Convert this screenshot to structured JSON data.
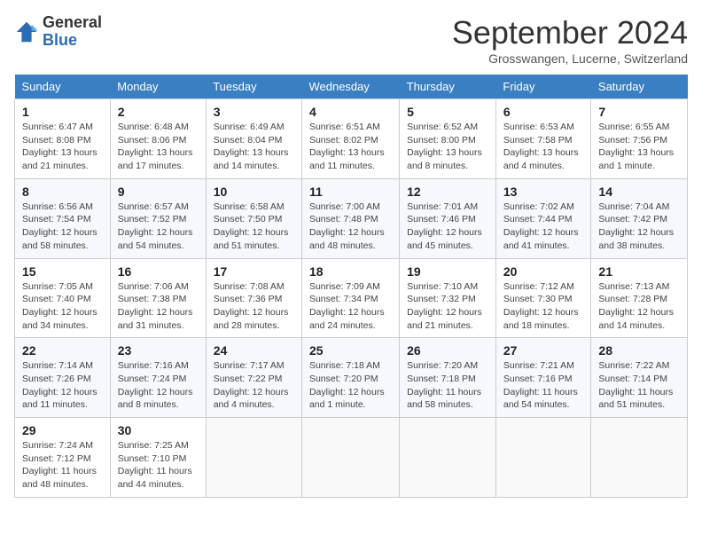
{
  "header": {
    "logo_general": "General",
    "logo_blue": "Blue",
    "month_title": "September 2024",
    "location": "Grosswangen, Lucerne, Switzerland"
  },
  "weekdays": [
    "Sunday",
    "Monday",
    "Tuesday",
    "Wednesday",
    "Thursday",
    "Friday",
    "Saturday"
  ],
  "weeks": [
    [
      {
        "day": "1",
        "sunrise": "Sunrise: 6:47 AM",
        "sunset": "Sunset: 8:08 PM",
        "daylight": "Daylight: 13 hours and 21 minutes."
      },
      {
        "day": "2",
        "sunrise": "Sunrise: 6:48 AM",
        "sunset": "Sunset: 8:06 PM",
        "daylight": "Daylight: 13 hours and 17 minutes."
      },
      {
        "day": "3",
        "sunrise": "Sunrise: 6:49 AM",
        "sunset": "Sunset: 8:04 PM",
        "daylight": "Daylight: 13 hours and 14 minutes."
      },
      {
        "day": "4",
        "sunrise": "Sunrise: 6:51 AM",
        "sunset": "Sunset: 8:02 PM",
        "daylight": "Daylight: 13 hours and 11 minutes."
      },
      {
        "day": "5",
        "sunrise": "Sunrise: 6:52 AM",
        "sunset": "Sunset: 8:00 PM",
        "daylight": "Daylight: 13 hours and 8 minutes."
      },
      {
        "day": "6",
        "sunrise": "Sunrise: 6:53 AM",
        "sunset": "Sunset: 7:58 PM",
        "daylight": "Daylight: 13 hours and 4 minutes."
      },
      {
        "day": "7",
        "sunrise": "Sunrise: 6:55 AM",
        "sunset": "Sunset: 7:56 PM",
        "daylight": "Daylight: 13 hours and 1 minute."
      }
    ],
    [
      {
        "day": "8",
        "sunrise": "Sunrise: 6:56 AM",
        "sunset": "Sunset: 7:54 PM",
        "daylight": "Daylight: 12 hours and 58 minutes."
      },
      {
        "day": "9",
        "sunrise": "Sunrise: 6:57 AM",
        "sunset": "Sunset: 7:52 PM",
        "daylight": "Daylight: 12 hours and 54 minutes."
      },
      {
        "day": "10",
        "sunrise": "Sunrise: 6:58 AM",
        "sunset": "Sunset: 7:50 PM",
        "daylight": "Daylight: 12 hours and 51 minutes."
      },
      {
        "day": "11",
        "sunrise": "Sunrise: 7:00 AM",
        "sunset": "Sunset: 7:48 PM",
        "daylight": "Daylight: 12 hours and 48 minutes."
      },
      {
        "day": "12",
        "sunrise": "Sunrise: 7:01 AM",
        "sunset": "Sunset: 7:46 PM",
        "daylight": "Daylight: 12 hours and 45 minutes."
      },
      {
        "day": "13",
        "sunrise": "Sunrise: 7:02 AM",
        "sunset": "Sunset: 7:44 PM",
        "daylight": "Daylight: 12 hours and 41 minutes."
      },
      {
        "day": "14",
        "sunrise": "Sunrise: 7:04 AM",
        "sunset": "Sunset: 7:42 PM",
        "daylight": "Daylight: 12 hours and 38 minutes."
      }
    ],
    [
      {
        "day": "15",
        "sunrise": "Sunrise: 7:05 AM",
        "sunset": "Sunset: 7:40 PM",
        "daylight": "Daylight: 12 hours and 34 minutes."
      },
      {
        "day": "16",
        "sunrise": "Sunrise: 7:06 AM",
        "sunset": "Sunset: 7:38 PM",
        "daylight": "Daylight: 12 hours and 31 minutes."
      },
      {
        "day": "17",
        "sunrise": "Sunrise: 7:08 AM",
        "sunset": "Sunset: 7:36 PM",
        "daylight": "Daylight: 12 hours and 28 minutes."
      },
      {
        "day": "18",
        "sunrise": "Sunrise: 7:09 AM",
        "sunset": "Sunset: 7:34 PM",
        "daylight": "Daylight: 12 hours and 24 minutes."
      },
      {
        "day": "19",
        "sunrise": "Sunrise: 7:10 AM",
        "sunset": "Sunset: 7:32 PM",
        "daylight": "Daylight: 12 hours and 21 minutes."
      },
      {
        "day": "20",
        "sunrise": "Sunrise: 7:12 AM",
        "sunset": "Sunset: 7:30 PM",
        "daylight": "Daylight: 12 hours and 18 minutes."
      },
      {
        "day": "21",
        "sunrise": "Sunrise: 7:13 AM",
        "sunset": "Sunset: 7:28 PM",
        "daylight": "Daylight: 12 hours and 14 minutes."
      }
    ],
    [
      {
        "day": "22",
        "sunrise": "Sunrise: 7:14 AM",
        "sunset": "Sunset: 7:26 PM",
        "daylight": "Daylight: 12 hours and 11 minutes."
      },
      {
        "day": "23",
        "sunrise": "Sunrise: 7:16 AM",
        "sunset": "Sunset: 7:24 PM",
        "daylight": "Daylight: 12 hours and 8 minutes."
      },
      {
        "day": "24",
        "sunrise": "Sunrise: 7:17 AM",
        "sunset": "Sunset: 7:22 PM",
        "daylight": "Daylight: 12 hours and 4 minutes."
      },
      {
        "day": "25",
        "sunrise": "Sunrise: 7:18 AM",
        "sunset": "Sunset: 7:20 PM",
        "daylight": "Daylight: 12 hours and 1 minute."
      },
      {
        "day": "26",
        "sunrise": "Sunrise: 7:20 AM",
        "sunset": "Sunset: 7:18 PM",
        "daylight": "Daylight: 11 hours and 58 minutes."
      },
      {
        "day": "27",
        "sunrise": "Sunrise: 7:21 AM",
        "sunset": "Sunset: 7:16 PM",
        "daylight": "Daylight: 11 hours and 54 minutes."
      },
      {
        "day": "28",
        "sunrise": "Sunrise: 7:22 AM",
        "sunset": "Sunset: 7:14 PM",
        "daylight": "Daylight: 11 hours and 51 minutes."
      }
    ],
    [
      {
        "day": "29",
        "sunrise": "Sunrise: 7:24 AM",
        "sunset": "Sunset: 7:12 PM",
        "daylight": "Daylight: 11 hours and 48 minutes."
      },
      {
        "day": "30",
        "sunrise": "Sunrise: 7:25 AM",
        "sunset": "Sunset: 7:10 PM",
        "daylight": "Daylight: 11 hours and 44 minutes."
      },
      null,
      null,
      null,
      null,
      null
    ]
  ]
}
